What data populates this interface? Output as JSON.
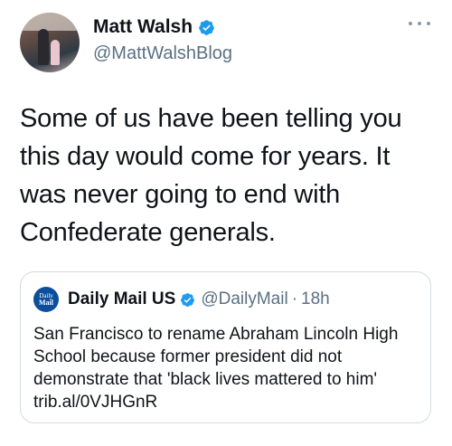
{
  "tweet": {
    "author_name": "Matt Walsh",
    "author_handle": "@MattWalshBlog",
    "text": "Some of us have been telling you this day would come for years. It was never going to end with Confederate generals."
  },
  "quoted_tweet": {
    "avatar_text_line1": "Daily",
    "avatar_text_line2": "Mail",
    "author_name": "Daily Mail US",
    "author_handle": "@DailyMail",
    "separator": "·",
    "time": "18h",
    "text": "San Francisco to rename Abraham Lincoln High School because former president did not demonstrate that 'black lives mattered to him' trib.al/0VJHGnR"
  },
  "colors": {
    "verified_blue": "#1d9bf0",
    "secondary_text": "#5b7083",
    "border": "#d4dbe1",
    "daily_mail_blue": "#0b4f9c"
  },
  "icons": {
    "verified": "verified-badge-icon",
    "more": "more-options-icon"
  }
}
